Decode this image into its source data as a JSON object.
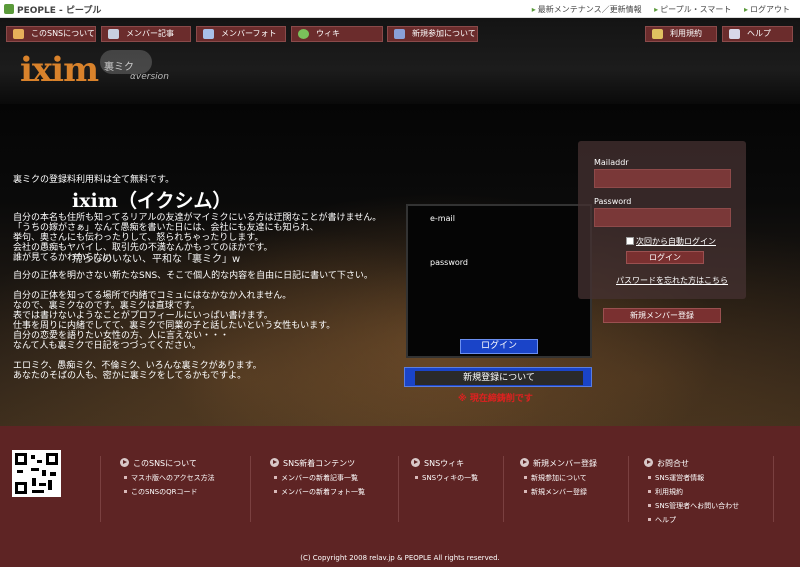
{
  "topbar": {
    "brand": "PEOPLE - ピープル",
    "links": [
      "最新メンテナンス／更新情報",
      "ピープル・スマート",
      "ログアウト"
    ]
  },
  "header": {
    "logo": "ixim",
    "logo_sub": "裏ミク",
    "logo_alpha": "αversion",
    "nav": [
      {
        "label": "このSNSについて",
        "icon": "home-icon"
      },
      {
        "label": "メンバー記事",
        "icon": "article-icon"
      },
      {
        "label": "メンバーフォト",
        "icon": "photo-icon"
      },
      {
        "label": "ウィキ",
        "icon": "globe-icon"
      },
      {
        "label": "新規参加について",
        "icon": "users-icon"
      }
    ],
    "nav_right": [
      {
        "label": "利用規約",
        "icon": "pencil-icon"
      },
      {
        "label": "ヘルプ",
        "icon": "help-icon"
      }
    ]
  },
  "hero": {
    "free_line": "裏ミクの登録料利用料は全て無料です。",
    "title": "ixim（イクシム）",
    "lines": [
      "自分の本名も住所も知ってるリアルの友達がマイミクにいる方は迂闊なことが書けません。",
      "「うちの嫁がさぁ」なんて愚痴を書いた日には、会社にも友達にも知られ、",
      "挙句、奥さんにも伝わったりして、怒られちゃったりします。",
      "会社の愚痴もヤバイし、取引先の不満なんかもってのほかです。",
      "誰が見てるかわからない"
    ],
    "quote": "荒らしのいない、平和な「裏ミク」w",
    "lines2": [
      "自分の正体を明かさない新たなSNS、そこで個人的な内容を自由に日記に書いて下さい。",
      "",
      "自分の正体を知ってる場所で内緒でコミュにはなかなか入れません。",
      "なので、裏ミクなのです。裏ミクは直球です。",
      "表では書けないようなことがプロフィールにいっぱい書けます。",
      "仕事を周りに内緒でしてて、裏ミクで同業の子と話したいという女性もいます。",
      "自分の恋愛を語りたい女性の方、人に言えない・・・",
      "なんて人も裏ミクで日記をつづってください。",
      "",
      "エロミク、愚痴ミク、不倫ミク、いろんな裏ミクがあります。",
      "あなたのそばの人も、密かに裏ミクをしてるかもですよ。"
    ]
  },
  "login": {
    "email_label": "e-mail",
    "password_label": "password",
    "button": "ログイン",
    "register_about": "新規登録について",
    "closed_note": "※ 現在締鋳削です"
  },
  "side_login": {
    "mail_label": "Mailaddr",
    "password_label": "Password",
    "auto_login": "次回から自動ログイン",
    "button": "ログイン",
    "forgot": "パスワードを忘れた方はこちら",
    "new_member": "新規メンバー登録"
  },
  "footer": {
    "columns": [
      {
        "head": "このSNSについて",
        "items": [
          "マスホ版へのアクセス方法",
          "このSNSのQRコード"
        ]
      },
      {
        "head": "SNS新着コンテンツ",
        "items": [
          "メンバーの新着記事一覧",
          "メンバーの新着フォト一覧"
        ]
      },
      {
        "head": "SNSウィキ",
        "items": [
          "SNSウィキの一覧"
        ]
      },
      {
        "head": "新規メンバー登録",
        "items": [
          "新規参加について",
          "新規メンバー登録"
        ]
      },
      {
        "head": "お問合せ",
        "items": [
          "SNS運営者情報",
          "利用規約",
          "SNS管理者へお問い合わせ",
          "ヘルプ"
        ]
      }
    ],
    "copyright": "(C) Copyright 2008 relav.jp & PEOPLE All rights reserved."
  }
}
